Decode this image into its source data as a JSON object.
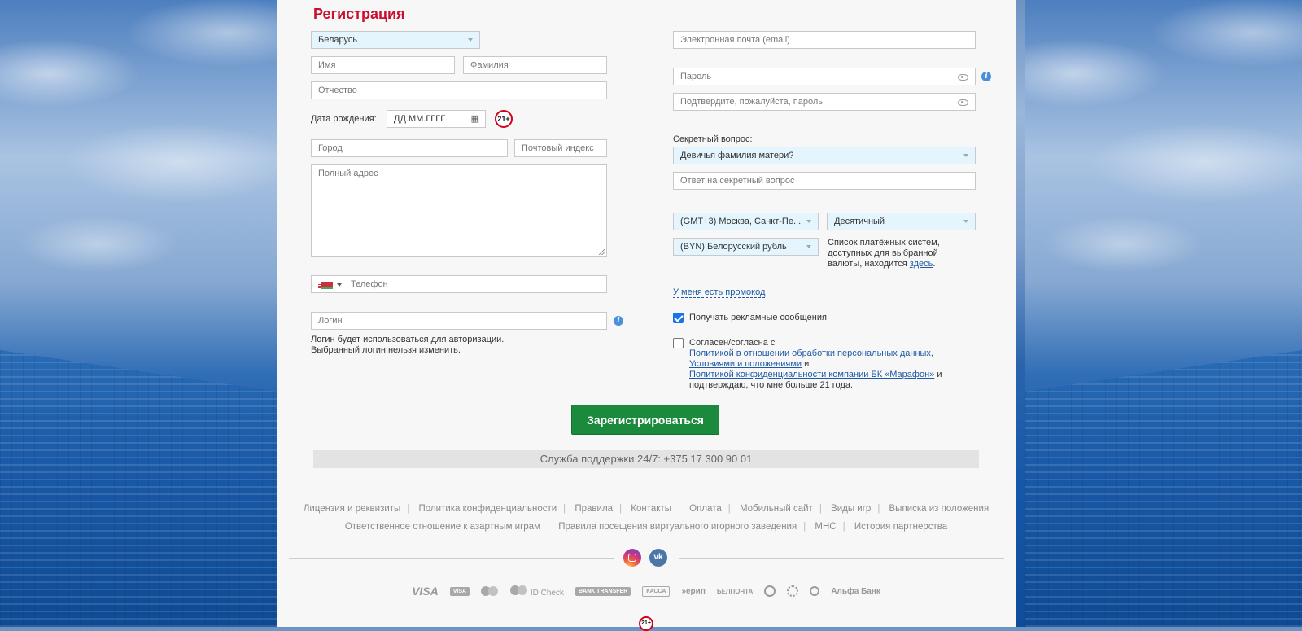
{
  "form": {
    "title": "Регистрация",
    "country_value": "Беларусь",
    "first_name_placeholder": "Имя",
    "last_name_placeholder": "Фамилия",
    "patronymic_placeholder": "Отчество",
    "birthdate_label": "Дата рождения:",
    "birthdate_placeholder": "ДД.ММ.ГГГГ",
    "age_badge": "21+",
    "city_placeholder": "Город",
    "postcode_placeholder": "Почтовый индекс",
    "address_placeholder": "Полный адрес",
    "phone_placeholder": "Телефон",
    "login_placeholder": "Логин",
    "login_hint_1": "Логин будет использоваться для авторизации.",
    "login_hint_2": "Выбранный логин нельзя изменить.",
    "email_placeholder": "Электронная почта (email)",
    "password_placeholder": "Пароль",
    "password_confirm_placeholder": "Подтвердите, пожалуйста, пароль",
    "secret_question_label": "Секретный вопрос:",
    "secret_question_value": "Девичья фамилия матери?",
    "secret_answer_placeholder": "Ответ на секретный вопрос",
    "timezone_value": "(GMT+3) Москва, Санкт-Пе...",
    "odds_format_value": "Десятичный",
    "currency_value": "(BYN) Белорусский рубль",
    "payment_note_1": "Список платёжных систем,",
    "payment_note_2": "доступных для выбранной",
    "payment_note_3": "валюты, находится",
    "payment_note_link": "здесь",
    "payment_note_end": ".",
    "promo_link": "У меня есть промокод",
    "ads_label": "Получать рекламные сообщения",
    "ads_checked": true,
    "consent_checked": false,
    "consent_1": "Согласен/согласна с",
    "consent_link_1": "Политикой в отношении обработки персональных данных,",
    "consent_link_2": "Условиями и положениями",
    "consent_and": "и",
    "consent_link_3": "Политикой конфиденциальности компании БК «Марафон»",
    "consent_and_2": "и",
    "consent_end": "подтверждаю, что мне больше 21 года.",
    "submit_label": "Зарегистрироваться"
  },
  "support": {
    "text": "Служба поддержки 24/7: +375 17 300 90 01"
  },
  "footer": {
    "row1": [
      "Лицензия и реквизиты",
      "Политика конфиденциальности",
      "Правила",
      "Контакты",
      "Оплата",
      "Мобильный сайт",
      "Виды игр",
      "Выписка из положения"
    ],
    "row2": [
      "Ответственное отношение к азартным играм",
      "Правила посещения виртуального игорного заведения",
      "МНС",
      "История партнерства"
    ],
    "social": {
      "instagram": "instagram-icon",
      "vk": "vk",
      "vk_label": "vk"
    },
    "payments": {
      "visa": "VISA",
      "visa_small": "VISA",
      "idcheck": "ID Check",
      "bank_transfer": "BANK TRANSFER",
      "kassa": "КАССА",
      "erip": "ерип",
      "belpochta": "БЕЛПОЧТА",
      "alfa": "Альфа Банк"
    },
    "age_badge": "21+"
  },
  "colors": {
    "accent": "#c8102e",
    "button": "#1b8a3c",
    "link": "#1f5aa6",
    "field_highlight": "#e4f5fd"
  }
}
